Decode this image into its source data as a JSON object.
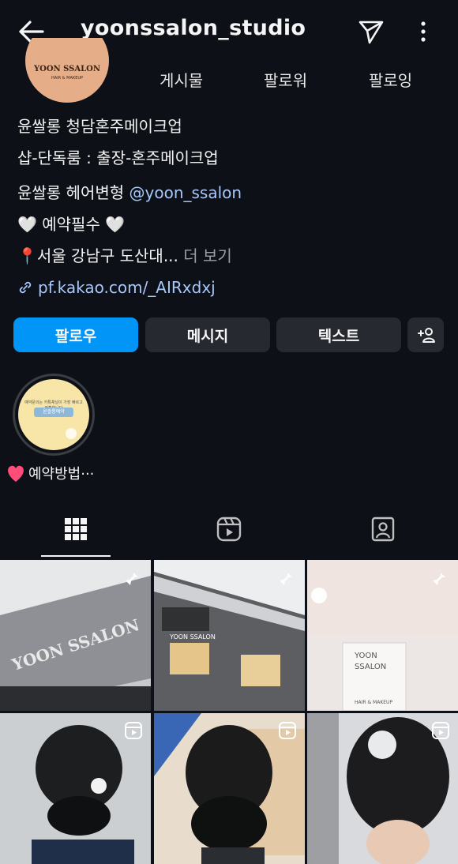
{
  "header": {
    "username": "yoonssalon_studio",
    "back_icon": "arrow-left-icon",
    "send_icon": "paper-plane-icon",
    "more_icon": "more-vertical-icon"
  },
  "profile": {
    "avatar": {
      "brand": "YOON SSALON",
      "sub": "HAIR & MAKEUP"
    },
    "stats": {
      "posts": "게시물",
      "followers": "팔로워",
      "following": "팔로잉"
    },
    "bio": {
      "line1": "윤쌀롱 청담혼주메이크업",
      "line2": "샵-단독룸 : 출장-혼주메이크업",
      "line3_prefix": "윤쌀롱 헤어변형 ",
      "line3_mention": "@yoon_ssalon",
      "line4": "🤍 예약필수 🤍",
      "line5": "📍서울 강남구 도산대...",
      "line5_more": " 더 보기",
      "link": "pf.kakao.com/_AIRxdxj"
    }
  },
  "actions": {
    "follow": "팔로우",
    "message": "메시지",
    "text": "텍스트"
  },
  "highlight": {
    "label": "예약방법···",
    "cover_text": "예약문의는 카톡채널이 가장 빠르고 정확합니다",
    "cover_tag": "윤쌀롱예약"
  },
  "tabs": [
    "grid-icon",
    "reels-icon",
    "tagged-icon"
  ],
  "grid": {
    "cell3_sign_line1": "YOON",
    "cell3_sign_line2": "SSALON",
    "cell3_sign_line3": "HAIR & MAKEUP",
    "cell1_sign": "YOON SSALON",
    "cell2_sign": "YOON SSALON"
  },
  "colors": {
    "background": "#0d1117",
    "primary": "#0095f6",
    "secondary_button": "#262a30",
    "link": "#a8c7fa"
  }
}
